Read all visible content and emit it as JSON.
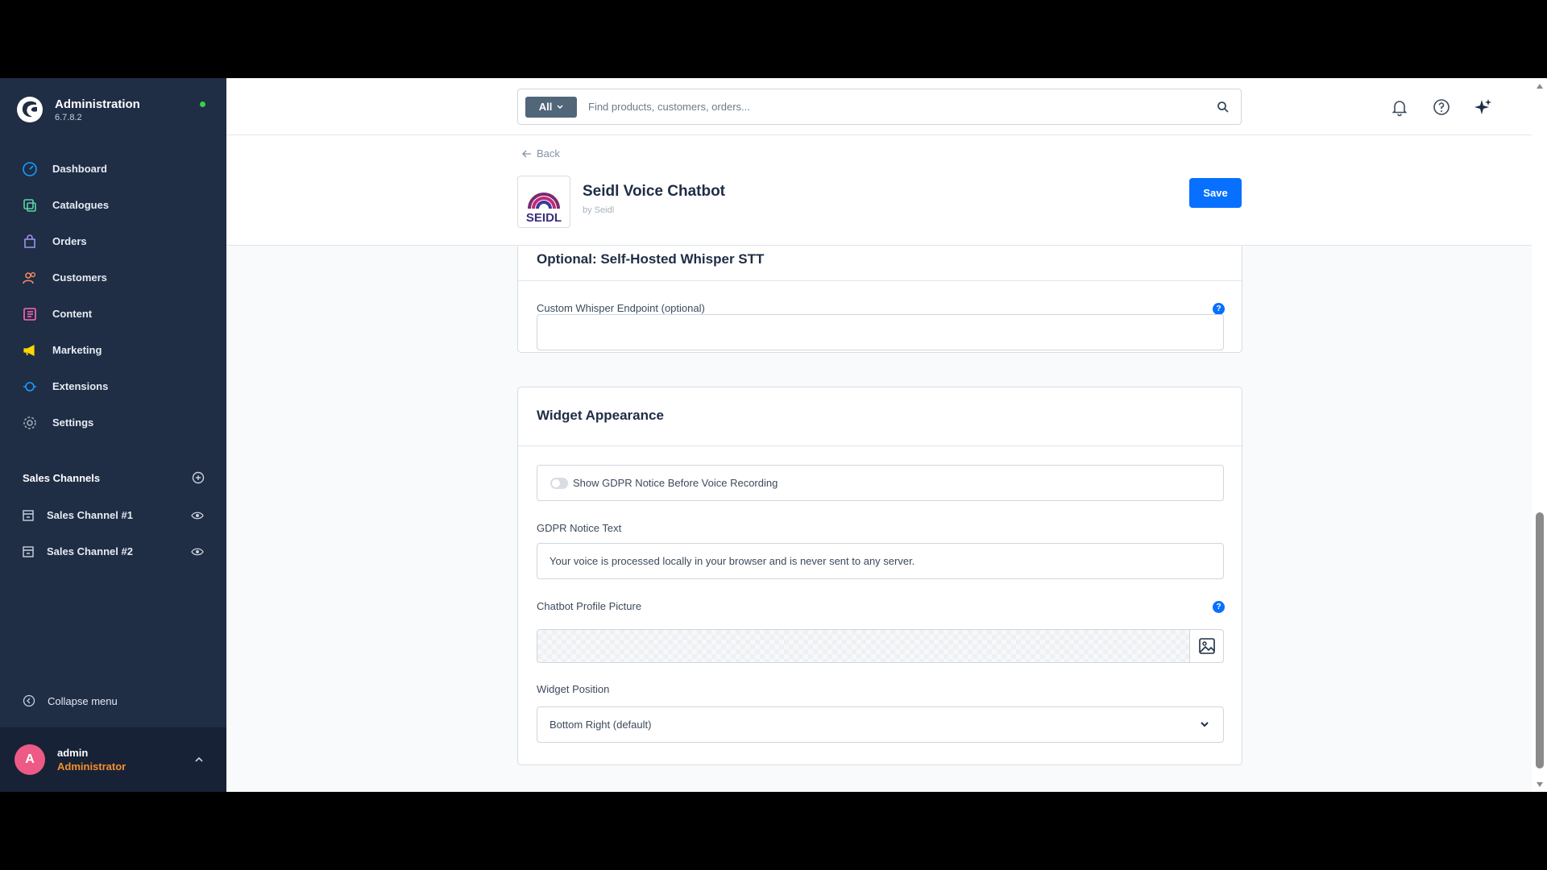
{
  "app": {
    "title": "Administration",
    "version": "6.7.8.2"
  },
  "sidebar": {
    "items": [
      {
        "label": "Dashboard",
        "icon": "dashboard-icon",
        "color": "#189eff"
      },
      {
        "label": "Catalogues",
        "icon": "catalogue-icon",
        "color": "#57d9a3"
      },
      {
        "label": "Orders",
        "icon": "orders-icon",
        "color": "#a092f0"
      },
      {
        "label": "Customers",
        "icon": "customers-icon",
        "color": "#f88962"
      },
      {
        "label": "Content",
        "icon": "content-icon",
        "color": "#ff68b4"
      },
      {
        "label": "Marketing",
        "icon": "marketing-icon",
        "color": "#ffd700"
      },
      {
        "label": "Extensions",
        "icon": "extensions-icon",
        "color": "#189eff"
      },
      {
        "label": "Settings",
        "icon": "settings-icon",
        "color": "#9aa8b5"
      }
    ],
    "sales_channels": {
      "title": "Sales Channels",
      "items": [
        {
          "label": "Sales Channel #1"
        },
        {
          "label": "Sales Channel #2"
        }
      ]
    },
    "collapse_label": "Collapse menu",
    "user": {
      "initial": "A",
      "name": "admin",
      "role": "Administrator"
    }
  },
  "topbar": {
    "search_type": "All",
    "search_placeholder": "Find products, customers, orders..."
  },
  "header": {
    "back_label": "Back",
    "plugin_title": "Seidl Voice Chatbot",
    "plugin_by": "by Seidl",
    "logo_text": "SEIDL",
    "save_label": "Save"
  },
  "cards": {
    "whisper": {
      "title": "Optional: Self-Hosted Whisper STT",
      "endpoint_label": "Custom Whisper Endpoint (optional)",
      "endpoint_value": ""
    },
    "widget": {
      "title": "Widget Appearance",
      "gdpr_toggle_label": "Show GDPR Notice Before Voice Recording",
      "gdpr_toggle_on": false,
      "gdpr_text_label": "GDPR Notice Text",
      "gdpr_text_value": "Your voice is processed locally in your browser and is never sent to any server.",
      "profile_picture_label": "Chatbot Profile Picture",
      "position_label": "Widget Position",
      "position_value": "Bottom Right (default)"
    }
  },
  "colors": {
    "sidebar_bg": "#1f2d45",
    "primary": "#0870ff",
    "online": "#37d046",
    "avatar": "#ed5a85",
    "role": "#f58f2c"
  }
}
